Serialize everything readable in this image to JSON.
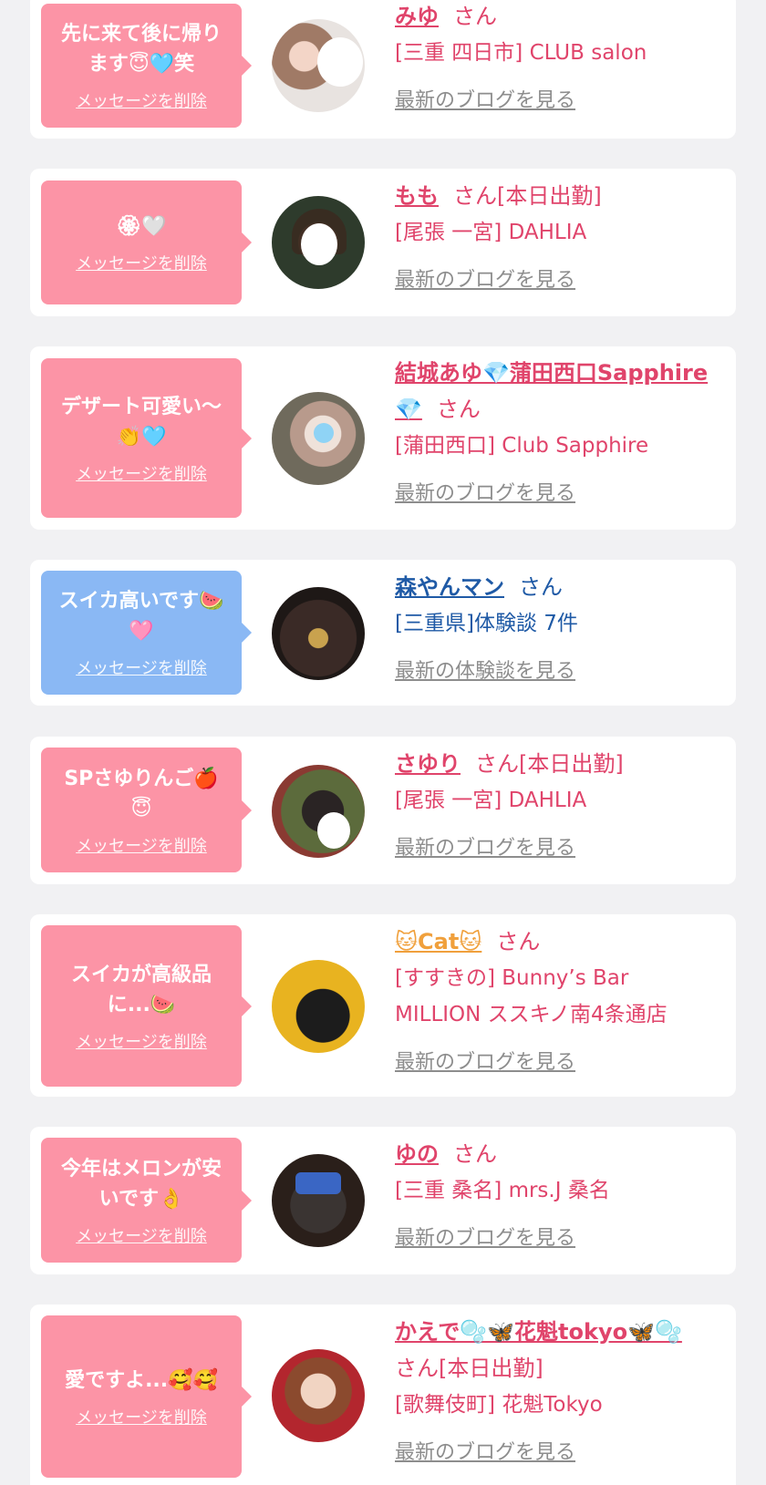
{
  "delete_label": "メッセージを削除",
  "colors": {
    "pink": "#fc94a6",
    "blue": "#8ab8f4",
    "pink_text": "#e0446b",
    "blue_text": "#1f5aa6",
    "gray_text": "#8d8d8d",
    "page_bg": "#f1f1f3"
  },
  "entries": [
    {
      "message": "先に来て後に帰り\nます😇🩵笑",
      "name": "みゆ",
      "san": "さん",
      "shop": "[三重 四日市] CLUB salon",
      "link": "最新のブログを見る",
      "theme": "pink"
    },
    {
      "message": "🏵🤍",
      "name": "もも",
      "san": "さん[本日出勤]",
      "shop": "[尾張 一宮] DAHLIA",
      "link": "最新のブログを見る",
      "theme": "pink"
    },
    {
      "message": "デザート可愛い〜\n👏🩵",
      "name": "結城あゆ💎蒲田西口Sapphire💎",
      "san": "さん",
      "shop": "[蒲田西口] Club Sapphire",
      "link": "最新のブログを見る",
      "theme": "pink"
    },
    {
      "message": "スイカ高いです🍉\n🩷",
      "name": "森やんマン",
      "san": "さん",
      "shop": "[三重県]体験談 7件",
      "link": "最新の体験談を見る",
      "theme": "blue"
    },
    {
      "message": "SPさゆりんご🍎\n😇",
      "name": "さゆり",
      "san": "さん[本日出勤]",
      "shop": "[尾張 一宮] DAHLIA",
      "link": "最新のブログを見る",
      "theme": "pink"
    },
    {
      "message": "スイカが高級品\nに...🍉",
      "name": "🐱Cat🐱",
      "san": "さん",
      "shop": "[すすきの] Bunny’s Bar MILLION ススキノ南4条通店",
      "link": "最新のブログを見る",
      "theme": "pink"
    },
    {
      "message": "今年はメロンが安\nいです👌",
      "name": "ゆの",
      "san": "さん",
      "shop": "[三重 桑名] mrs.J 桑名",
      "link": "最新のブログを見る",
      "theme": "pink"
    },
    {
      "message": "愛ですよ...🥰🥰",
      "name": "かえで🫧🦋花魁tokyo🦋🫧",
      "san": "さん[本日出勤]",
      "shop": "[歌舞伎町] 花魁Tokyo",
      "link": "最新のブログを見る",
      "theme": "pink"
    }
  ]
}
